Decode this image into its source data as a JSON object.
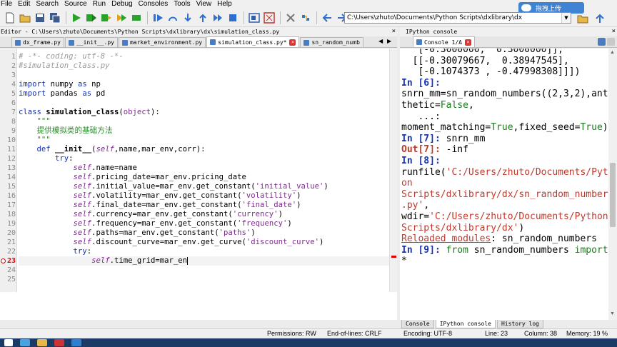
{
  "menu": [
    "File",
    "Edit",
    "Search",
    "Source",
    "Run",
    "Debug",
    "Consoles",
    "Tools",
    "View",
    "Help"
  ],
  "toolbar": {
    "path": "C:\\Users\\zhuto\\Documents\\Python Scripts\\dxlibrary\\dx",
    "upload_label": "拖拽上传"
  },
  "editor": {
    "title": "Editor - C:\\Users\\zhuto\\Documents\\Python Scripts\\dxlibrary\\dx\\simulation_class.py",
    "tabs": [
      {
        "label": "dx_frame.py",
        "active": false
      },
      {
        "label": "__init__.py",
        "active": false
      },
      {
        "label": "market_environment.py",
        "active": false
      },
      {
        "label": "simulation_class.py*",
        "active": true
      },
      {
        "label": "sn_random_numb",
        "active": false
      }
    ],
    "current_line": 23,
    "error_line": 23,
    "line_count": 25,
    "lines": [
      {
        "n": "1",
        "segs": [
          [
            "comment",
            "# -*- coding: utf-8 -*-"
          ]
        ]
      },
      {
        "n": "2",
        "segs": [
          [
            "comment",
            "#simulation_class.py"
          ]
        ]
      },
      {
        "n": "3",
        "segs": []
      },
      {
        "n": "4",
        "segs": [
          [
            "kw",
            "import"
          ],
          [
            "",
            " numpy "
          ],
          [
            "kw",
            "as"
          ],
          [
            "",
            " np"
          ]
        ]
      },
      {
        "n": "5",
        "segs": [
          [
            "kw",
            "import"
          ],
          [
            "",
            " pandas "
          ],
          [
            "kw",
            "as"
          ],
          [
            "",
            " pd"
          ]
        ]
      },
      {
        "n": "6",
        "segs": []
      },
      {
        "n": "7",
        "segs": [
          [
            "kw",
            "class"
          ],
          [
            "",
            " "
          ],
          [
            "cls",
            "simulation_class"
          ],
          [
            "",
            "("
          ],
          [
            "str",
            "object"
          ],
          [
            "",
            "):"
          ]
        ]
      },
      {
        "n": "8",
        "segs": [
          [
            "",
            "    "
          ],
          [
            "hl",
            "\"\"\""
          ]
        ]
      },
      {
        "n": "9",
        "segs": [
          [
            "",
            "    "
          ],
          [
            "hl",
            "提供模拟类的基础方法"
          ]
        ]
      },
      {
        "n": "10",
        "segs": [
          [
            "",
            "    "
          ],
          [
            "hl",
            "\"\"\""
          ]
        ]
      },
      {
        "n": "11",
        "segs": [
          [
            "",
            "    "
          ],
          [
            "kw",
            "def"
          ],
          [
            "",
            " "
          ],
          [
            "cls",
            "__init__"
          ],
          [
            "",
            "("
          ],
          [
            "self",
            "self"
          ],
          [
            "",
            ",name,mar_env,corr):"
          ]
        ]
      },
      {
        "n": "12",
        "segs": [
          [
            "",
            "        "
          ],
          [
            "kw",
            "try"
          ],
          [
            "",
            ":"
          ]
        ]
      },
      {
        "n": "13",
        "segs": [
          [
            "",
            "            "
          ],
          [
            "self",
            "self"
          ],
          [
            "",
            ".name=name"
          ]
        ]
      },
      {
        "n": "14",
        "segs": [
          [
            "",
            "            "
          ],
          [
            "self",
            "self"
          ],
          [
            "",
            ".pricing_date=mar_env.pricing_date"
          ]
        ]
      },
      {
        "n": "15",
        "segs": [
          [
            "",
            "            "
          ],
          [
            "self",
            "self"
          ],
          [
            "",
            ".initial_value=mar_env.get_constant("
          ],
          [
            "str",
            "'initial_value'"
          ],
          [
            "",
            ")"
          ]
        ]
      },
      {
        "n": "16",
        "segs": [
          [
            "",
            "            "
          ],
          [
            "self",
            "self"
          ],
          [
            "",
            ".volatility=mar_env.get_constant("
          ],
          [
            "str",
            "'volatility'"
          ],
          [
            "",
            ")"
          ]
        ]
      },
      {
        "n": "17",
        "segs": [
          [
            "",
            "            "
          ],
          [
            "self",
            "self"
          ],
          [
            "",
            ".final_date=mar_env.get_constant("
          ],
          [
            "str",
            "'final_date'"
          ],
          [
            "",
            ")"
          ]
        ]
      },
      {
        "n": "18",
        "segs": [
          [
            "",
            "            "
          ],
          [
            "self",
            "self"
          ],
          [
            "",
            ".currency=mar_env.get_constant("
          ],
          [
            "str",
            "'currency'"
          ],
          [
            "",
            ")"
          ]
        ]
      },
      {
        "n": "19",
        "segs": [
          [
            "",
            "            "
          ],
          [
            "self",
            "self"
          ],
          [
            "",
            ".frequency=mar_env.get_constant("
          ],
          [
            "str",
            "'frequency'"
          ],
          [
            "",
            ")"
          ]
        ]
      },
      {
        "n": "20",
        "segs": [
          [
            "",
            "            "
          ],
          [
            "self",
            "self"
          ],
          [
            "",
            ".paths=mar_env.get_constant("
          ],
          [
            "str",
            "'paths'"
          ],
          [
            "",
            ")"
          ]
        ]
      },
      {
        "n": "21",
        "segs": [
          [
            "",
            "            "
          ],
          [
            "self",
            "self"
          ],
          [
            "",
            ".discount_curve=mar_env.get_curve("
          ],
          [
            "str",
            "'discount_curve'"
          ],
          [
            "",
            ")"
          ]
        ]
      },
      {
        "n": "22",
        "segs": [
          [
            "",
            "            "
          ],
          [
            "kw",
            "try"
          ],
          [
            "",
            ":"
          ]
        ]
      },
      {
        "n": "23",
        "segs": [
          [
            "",
            "                "
          ],
          [
            "self",
            "self"
          ],
          [
            "",
            ".time_grid=mar_en"
          ]
        ]
      },
      {
        "n": "24",
        "segs": []
      },
      {
        "n": "25",
        "segs": []
      }
    ]
  },
  "console": {
    "title": "IPython console",
    "tab_label": "Console 1/A",
    "lines": [
      [
        [
          "",
          "   [-0.3000000,  0.3000000]],"
        ]
      ],
      [
        [
          "",
          ""
        ]
      ],
      [
        [
          "",
          "  [[-0.30079667,  0.38947545],"
        ]
      ],
      [
        [
          "",
          "   [-0.1074373 , -0.47998308]]])"
        ]
      ],
      [
        [
          "",
          ""
        ]
      ],
      [
        [
          "cin",
          "In [6]:"
        ]
      ],
      [
        [
          "",
          "snrn_mm=sn_random_numbers((2,3,2),anti"
        ]
      ],
      [
        [
          "",
          "thetic="
        ],
        [
          "ckw",
          "False"
        ],
        [
          "",
          ","
        ]
      ],
      [
        [
          "",
          "   ...:"
        ]
      ],
      [
        [
          "",
          "moment_matching="
        ],
        [
          "ckw",
          "True"
        ],
        [
          "",
          ",fixed_seed="
        ],
        [
          "ckw",
          "True"
        ],
        [
          "",
          ")"
        ]
      ],
      [
        [
          "",
          ""
        ]
      ],
      [
        [
          "cin",
          "In [7]:"
        ],
        [
          "",
          " snrn_mm"
        ]
      ],
      [
        [
          "cout",
          "Out[7]:"
        ],
        [
          "",
          " -inf"
        ]
      ],
      [
        [
          "",
          ""
        ]
      ],
      [
        [
          "cin",
          "In [8]:"
        ]
      ],
      [
        [
          "",
          "runfile("
        ],
        [
          "cstr",
          "'C:/Users/zhuto/Documents/Pyth"
        ]
      ],
      [
        [
          "cstr",
          "on"
        ]
      ],
      [
        [
          "cstr",
          "Scripts/dxlibrary/dx/sn_random_numbers"
        ]
      ],
      [
        [
          "cstr",
          ".py'"
        ],
        [
          "",
          ","
        ]
      ],
      [
        [
          "",
          "wdir="
        ],
        [
          "cstr",
          "'C:/Users/zhuto/Documents/Python"
        ]
      ],
      [
        [
          "cstr",
          "Scripts/dxlibrary/dx'"
        ],
        [
          "",
          ")"
        ]
      ],
      [
        [
          "cul",
          "Reloaded modules"
        ],
        [
          "",
          ": sn_random_numbers"
        ]
      ],
      [
        [
          "",
          ""
        ]
      ],
      [
        [
          "cin",
          "In [9]:"
        ],
        [
          "",
          " "
        ],
        [
          "ckw",
          "from"
        ],
        [
          "",
          " sn_random_numbers "
        ],
        [
          "ckw",
          "import"
        ]
      ],
      [
        [
          "",
          "*"
        ]
      ]
    ],
    "bottom_tabs": [
      {
        "label": "Console",
        "active": false
      },
      {
        "label": "IPython console",
        "active": true
      },
      {
        "label": "History log",
        "active": false
      }
    ]
  },
  "status": {
    "permissions": "Permissions: RW",
    "eol": "End-of-lines: CRLF",
    "encoding": "Encoding: UTF-8",
    "line": "Line: 23",
    "column": "Column: 38",
    "memory": "Memory: 19 %"
  }
}
